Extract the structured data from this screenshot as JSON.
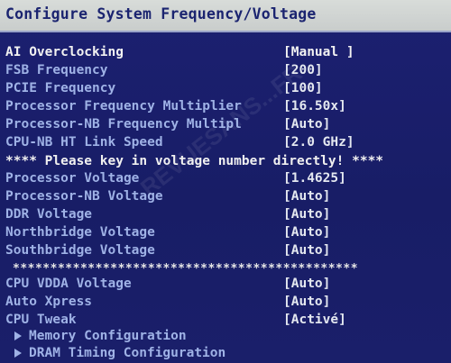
{
  "title": "Configure System Frequency/Voltage",
  "settings_group1": [
    {
      "label": "AI Overclocking",
      "value": "[Manual ]"
    },
    {
      "label": "FSB Frequency",
      "value": "[200]"
    },
    {
      "label": "PCIE Frequency",
      "value": "[100]"
    },
    {
      "label": "Processor Frequency Multiplier",
      "value": "[16.50x]"
    },
    {
      "label": "Processor-NB Frequency Multipl",
      "value": "[Auto]"
    },
    {
      "label": "CPU-NB HT Link Speed",
      "value": "[2.0 GHz]"
    }
  ],
  "voltage_notice": "**** Please key in voltage number directly! ****",
  "settings_group2": [
    {
      "label": "Processor Voltage",
      "value": "[1.4625]"
    },
    {
      "label": "Processor-NB Voltage",
      "value": "[Auto]"
    },
    {
      "label": "DDR Voltage",
      "value": "[Auto]"
    },
    {
      "label": "Northbridge Voltage",
      "value": "[Auto]"
    },
    {
      "label": "Southbridge Voltage",
      "value": "[Auto]"
    }
  ],
  "separator": "**********************************************",
  "settings_group3": [
    {
      "label": "CPU VDDA Voltage",
      "value": "[Auto]"
    },
    {
      "label": "Auto Xpress",
      "value": "[Auto]"
    },
    {
      "label": "CPU Tweak",
      "value": "[Activé]"
    }
  ],
  "submenus": [
    {
      "label": "Memory Configuration"
    },
    {
      "label": "DRAM Timing Configuration"
    }
  ],
  "watermark": "REVUESANS...FR",
  "colors": {
    "background": "#1a1f6e",
    "title_bar": "#d0d4d2",
    "label": "#9fb2e6",
    "value": "#e4e8f0",
    "selected": "#f2f2f2"
  },
  "icons": {
    "submenu_arrow": "triangle-right-icon"
  }
}
